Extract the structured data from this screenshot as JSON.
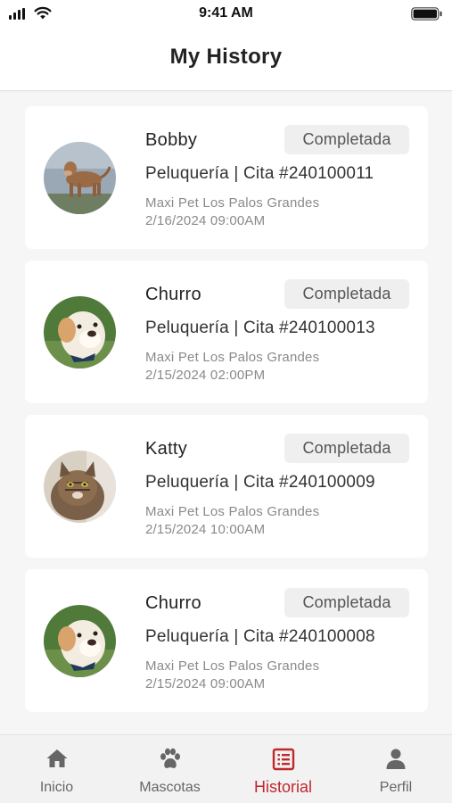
{
  "status_bar": {
    "time": "9:41 AM"
  },
  "header": {
    "title": "My History"
  },
  "appointments": [
    {
      "pet_name": "Bobby",
      "status": "Completada",
      "service": "Peluquería | Cita #240100011",
      "location": "Maxi Pet Los Palos Grandes",
      "datetime": "2/16/2024 09:00AM",
      "avatar_icon": "dog-photo"
    },
    {
      "pet_name": "Churro",
      "status": "Completada",
      "service": "Peluquería | Cita #240100013",
      "location": "Maxi Pet Los Palos Grandes",
      "datetime": "2/15/2024 02:00PM",
      "avatar_icon": "dog-photo"
    },
    {
      "pet_name": "Katty",
      "status": "Completada",
      "service": "Peluquería | Cita #240100009",
      "location": "Maxi Pet Los Palos Grandes",
      "datetime": "2/15/2024 10:00AM",
      "avatar_icon": "cat-photo"
    },
    {
      "pet_name": "Churro",
      "status": "Completada",
      "service": "Peluquería | Cita #240100008",
      "location": "Maxi Pet Los Palos Grandes",
      "datetime": "2/15/2024 09:00AM",
      "avatar_icon": "dog-photo"
    }
  ],
  "tabs": [
    {
      "label": "Inicio",
      "icon": "home-icon",
      "active": false
    },
    {
      "label": "Mascotas",
      "icon": "paw-icon",
      "active": false
    },
    {
      "label": "Historial",
      "icon": "list-icon",
      "active": true
    },
    {
      "label": "Perfil",
      "icon": "person-icon",
      "active": false
    }
  ],
  "colors": {
    "accent": "#c0282c",
    "background": "#f6f6f6",
    "card": "#ffffff",
    "status_pill": "#efefef",
    "muted_text": "#8a8a8a"
  }
}
